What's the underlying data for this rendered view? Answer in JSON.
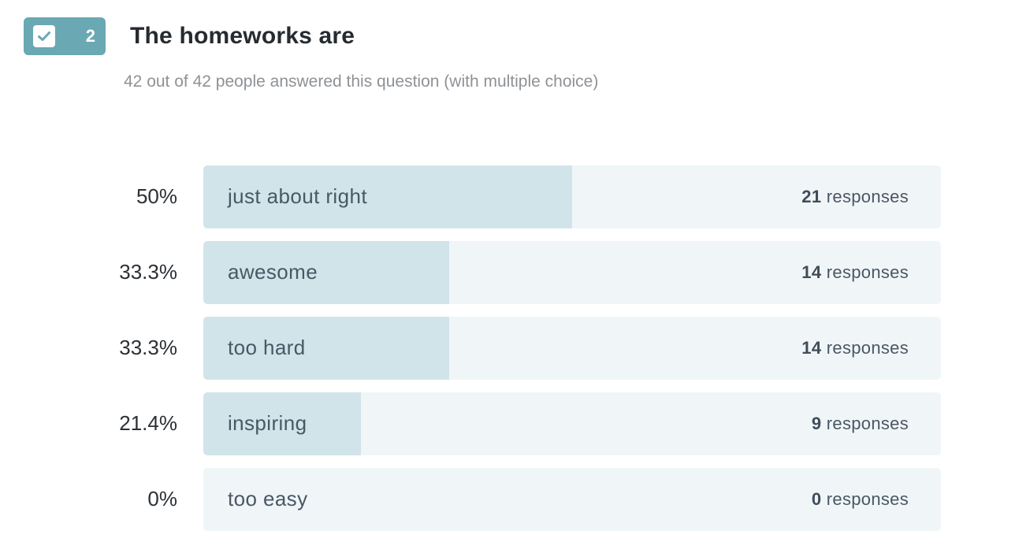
{
  "question": {
    "number": "2",
    "title": "The homeworks are",
    "summary": "42 out of 42 people answered this question (with multiple choice)"
  },
  "colors": {
    "badge": "#6aa8b4",
    "bar_fill": "#d1e4ea",
    "bar_track": "#f0f6f8"
  },
  "responses_word": "responses",
  "answers": [
    {
      "label": "just about right",
      "percent": "50%",
      "fraction": 0.5,
      "count": "21"
    },
    {
      "label": "awesome",
      "percent": "33.3%",
      "fraction": 0.333,
      "count": "14"
    },
    {
      "label": "too hard",
      "percent": "33.3%",
      "fraction": 0.333,
      "count": "14"
    },
    {
      "label": "inspiring",
      "percent": "21.4%",
      "fraction": 0.214,
      "count": "9"
    },
    {
      "label": "too easy",
      "percent": "0%",
      "fraction": 0,
      "count": "0"
    }
  ]
}
